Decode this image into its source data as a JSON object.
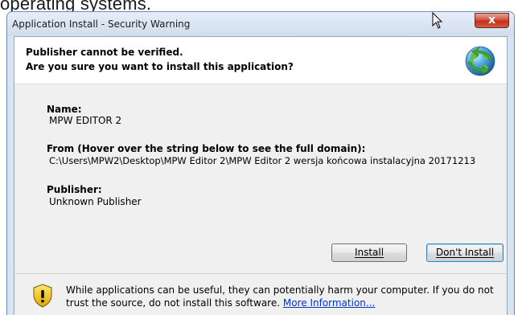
{
  "background_caption": "operating systems.",
  "window": {
    "title": "Application Install - Security Warning",
    "close_label": "x"
  },
  "header": {
    "line1": "Publisher cannot be verified.",
    "line2": "Are you sure you want to install this application?"
  },
  "details": {
    "name_label": "Name:",
    "name_value": "MPW EDITOR 2",
    "from_label": "From (Hover over the string below to see the full domain):",
    "from_value": "C:\\Users\\MPW2\\Desktop\\MPW Editor 2\\MPW Editor 2 wersja końcowa instalacyjna 20171213",
    "publisher_label": "Publisher:",
    "publisher_value": "Unknown Publisher"
  },
  "buttons": {
    "install": "Install",
    "dont_install": "Don't Install"
  },
  "warning": {
    "text": "While applications can be useful, they can potentially harm your computer. If you do not trust the source, do not install this software.",
    "link": "More Information..."
  },
  "colors": {
    "link": "#0033cc",
    "close_button": "#c8412a",
    "shield": "#f2c21a"
  },
  "icons": [
    "globe-arrow-icon",
    "shield-warning-icon",
    "close-icon",
    "mouse-cursor-icon"
  ]
}
